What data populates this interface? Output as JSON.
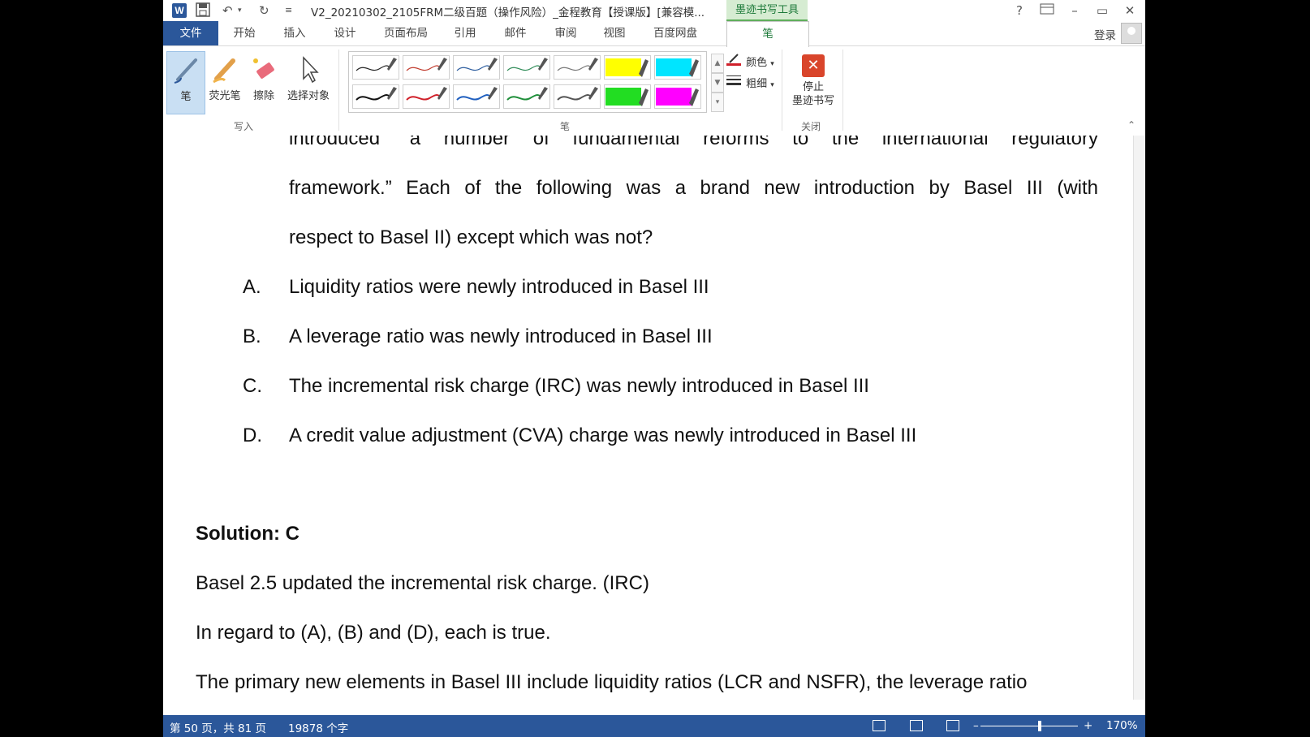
{
  "window": {
    "title": "V2_20210302_2105FRM二级百题（操作风险）_金程教育【授课版】[兼容模...",
    "context_tab": "墨迹书写工具",
    "help": "?",
    "minimize": "–",
    "restore": "▭",
    "close": "✕"
  },
  "menu": {
    "file": "文件",
    "tabs": [
      "开始",
      "插入",
      "设计",
      "页面布局",
      "引用",
      "邮件",
      "审阅",
      "视图",
      "百度网盘",
      "笔"
    ],
    "login": "登录"
  },
  "ribbon": {
    "write_group": {
      "label": "写入",
      "pen": "笔",
      "highlighter": "荧光笔",
      "eraser": "擦除",
      "select": "选择对象"
    },
    "pens_group": {
      "label": "笔",
      "color": "颜色",
      "thickness": "粗细"
    },
    "close_group": {
      "label": "关闭",
      "stop_line1": "停止",
      "stop_line2": "墨迹书写"
    },
    "pen_swatches": [
      "#222222",
      "#c0392b",
      "#2b5c9e",
      "#2e8b57",
      "#777777",
      "#ffff00",
      "#00e5ff",
      "#111111",
      "#d0202a",
      "#1f5fbf",
      "#1f8f3a",
      "#555555",
      "#22dd22",
      "#ff00ff"
    ]
  },
  "document": {
    "line1": "introduced “a number of fundamental reforms to the international regulatory",
    "line2": "framework.” Each of the following was a brand new introduction by Basel III (with",
    "line3": "respect to Basel II) except which was not?",
    "options": [
      {
        "letter": "A.",
        "text": "Liquidity ratios were newly introduced in Basel III"
      },
      {
        "letter": "B.",
        "text": "A leverage ratio was newly introduced in Basel III"
      },
      {
        "letter": "C.",
        "text": "The incremental risk charge (IRC) was newly introduced in Basel III"
      },
      {
        "letter": "D.",
        "text": "A credit value adjustment (CVA) charge was newly introduced in Basel III"
      }
    ],
    "solution": "Solution: C",
    "explanation1": "Basel 2.5 updated the incremental risk charge. (IRC)",
    "explanation2": "In regard to (A), (B) and (D), each is true.",
    "explanation3": "The primary new elements in Basel III include liquidity ratios (LCR and NSFR), the leverage ratio"
  },
  "status": {
    "page": "第 50 页，共 81 页",
    "words": "19878 个字",
    "zoom": "170%",
    "zoom_minus": "–",
    "zoom_plus": "+"
  }
}
